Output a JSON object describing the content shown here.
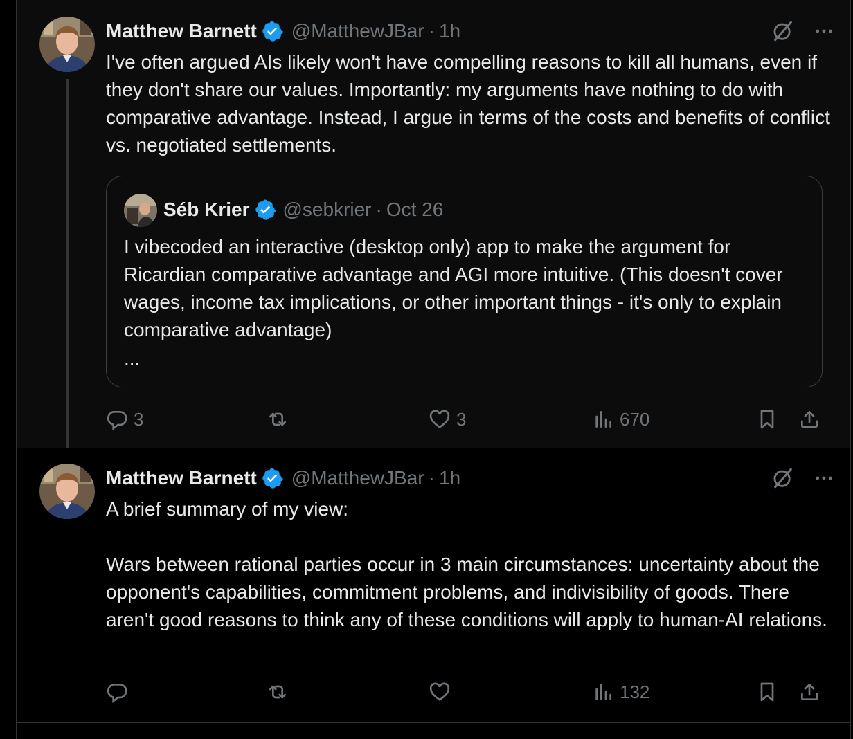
{
  "tweets": [
    {
      "author_name": "Matthew Barnett",
      "handle": "@MatthewJBar",
      "separator": "·",
      "time": "1h",
      "text": "I've often argued AIs likely won't have compelling reasons to kill all humans, even if they don't share our values. Importantly: my arguments have nothing to do with comparative advantage. Instead, I argue in terms of the costs and benefits of conflict vs. negotiated settlements.",
      "quote": {
        "author_name": "Séb Krier",
        "handle": "@sebkrier",
        "separator": "·",
        "date": "Oct 26",
        "text": "I vibecoded an interactive (desktop only) app to make the argument for Ricardian comparative advantage and AGI more intuitive. (This doesn't cover wages, income tax implications, or other important things - it's only to explain comparative advantage)",
        "more": "..."
      },
      "replies": "3",
      "reposts": "",
      "likes": "3",
      "views": "670"
    },
    {
      "author_name": "Matthew Barnett",
      "handle": "@MatthewJBar",
      "separator": "·",
      "time": "1h",
      "text_line1": "A brief summary of my view:",
      "text_para2": "Wars between rational parties occur in 3 main circumstances: uncertainty about the opponent's capabilities, commitment problems, and indivisibility of goods. There aren't good reasons to think any of these conditions will apply to human-AI relations.",
      "replies": "",
      "reposts": "",
      "likes": "",
      "views": "132"
    }
  ],
  "colors": {
    "background": "#000000",
    "text": "#e7e9ea",
    "secondary": "#71767b",
    "verified": "#1d9bf0",
    "border": "#2f3336"
  },
  "icons": [
    "verified-badge-icon",
    "grok-icon",
    "more-icon",
    "reply-icon",
    "repost-icon",
    "like-icon",
    "views-icon",
    "bookmark-icon",
    "share-icon"
  ]
}
